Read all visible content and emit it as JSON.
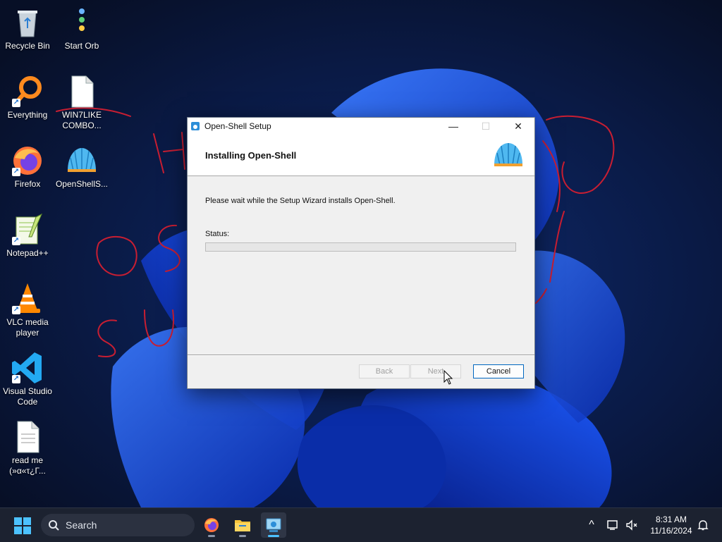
{
  "desktop": {
    "icons": [
      {
        "label": "Recycle Bin",
        "icon": "recycle-bin-icon"
      },
      {
        "label": "Start Orb",
        "icon": "start-orb-icon"
      },
      {
        "label": "Everything",
        "icon": "everything-icon"
      },
      {
        "label": "WIN7LIKE COMBO...",
        "icon": "document-icon"
      },
      {
        "label": "Firefox",
        "icon": "firefox-icon"
      },
      {
        "label": "OpenShellS...",
        "icon": "openshell-icon"
      },
      {
        "label": "Notepad++",
        "icon": "notepadpp-icon"
      },
      {
        "label": "VLC media player",
        "icon": "vlc-icon"
      },
      {
        "label": "Visual Studio Code",
        "icon": "vscode-icon"
      },
      {
        "label": "read me (»α«τ¿Γ...",
        "icon": "document-icon"
      }
    ]
  },
  "dialog": {
    "title": "Open-Shell Setup",
    "heading": "Installing Open-Shell",
    "message": "Please wait while the Setup Wizard installs Open-Shell.",
    "status_label": "Status:",
    "progress": 0,
    "buttons": {
      "back": "Back",
      "next": "Next",
      "cancel": "Cancel"
    },
    "controls": {
      "minimize": "—",
      "maximize": "☐",
      "close": "✕"
    }
  },
  "taskbar": {
    "search_text": "Search",
    "apps": [
      "firefox-icon",
      "file-explorer-icon",
      "openshell-setup-icon"
    ],
    "clock": {
      "time": "8:31 AM",
      "date": "11/16/2024"
    },
    "tray_chevron": "^"
  },
  "colors": {
    "accent": "#0067c0",
    "taskbar": "#1c2230",
    "scribble": "#c81e32"
  }
}
